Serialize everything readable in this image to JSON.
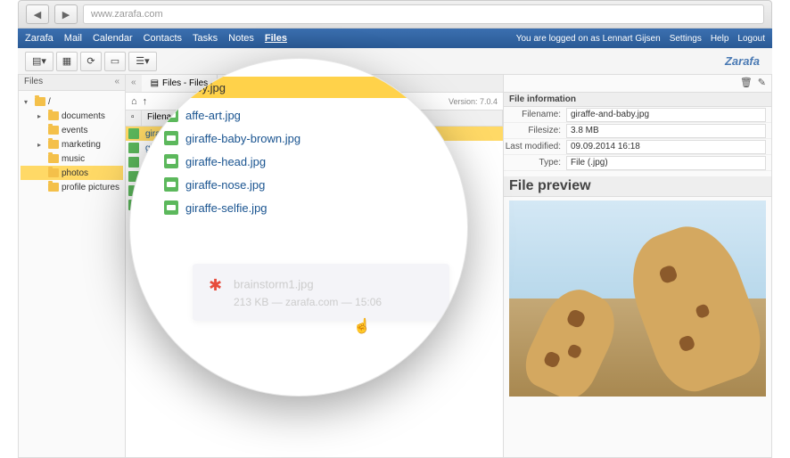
{
  "browser": {
    "url": "www.zarafa.com"
  },
  "menubar": {
    "items": [
      "Zarafa",
      "Mail",
      "Calendar",
      "Contacts",
      "Tasks",
      "Notes",
      "Files"
    ],
    "active_index": 6,
    "logged_text": "You are logged on as Lennart Gijsen",
    "settings": "Settings",
    "help": "Help",
    "logout": "Logout"
  },
  "brand": "Zarafa",
  "sidebar": {
    "header": "Files",
    "root": "/",
    "folders": [
      {
        "name": "documents",
        "indent": 1
      },
      {
        "name": "events",
        "indent": 1
      },
      {
        "name": "marketing",
        "indent": 1
      },
      {
        "name": "music",
        "indent": 1
      },
      {
        "name": "photos",
        "indent": 1,
        "selected": true
      },
      {
        "name": "profile pictures",
        "indent": 1
      }
    ]
  },
  "tabs": {
    "label": "Files - Files"
  },
  "pathbar": {
    "version": "Version: 7.0.4"
  },
  "columns": {
    "filename": "Filename ▲"
  },
  "files": [
    {
      "name": "giraffe-and-baby.jpg",
      "selected": true
    },
    {
      "name": "giraffe-art.jpg"
    },
    {
      "name": "giraffe-baby-brown.jpg"
    },
    {
      "name": "giraffe-head.jpg"
    },
    {
      "name": "giraffe-nose.jpg"
    },
    {
      "name": "giraffe-selfie.jpg"
    }
  ],
  "magnifier": {
    "selected_suffix": "nd-baby.jpg",
    "list": [
      "affe-art.jpg",
      "giraffe-baby-brown.jpg",
      "giraffe-head.jpg",
      "giraffe-nose.jpg",
      "giraffe-selfie.jpg"
    ],
    "download": {
      "name": "brainstorm1.jpg",
      "meta": "213 KB — zarafa.com — 15:06"
    }
  },
  "info": {
    "header": "File information",
    "rows": {
      "filename_label": "Filename:",
      "filename_value": "giraffe-and-baby.jpg",
      "filesize_label": "Filesize:",
      "filesize_value": "3.8 MB",
      "modified_label": "Last modified:",
      "modified_value": "09.09.2014 16:18",
      "type_label": "Type:",
      "type_value": "File (.jpg)"
    },
    "preview_header": "File preview"
  }
}
